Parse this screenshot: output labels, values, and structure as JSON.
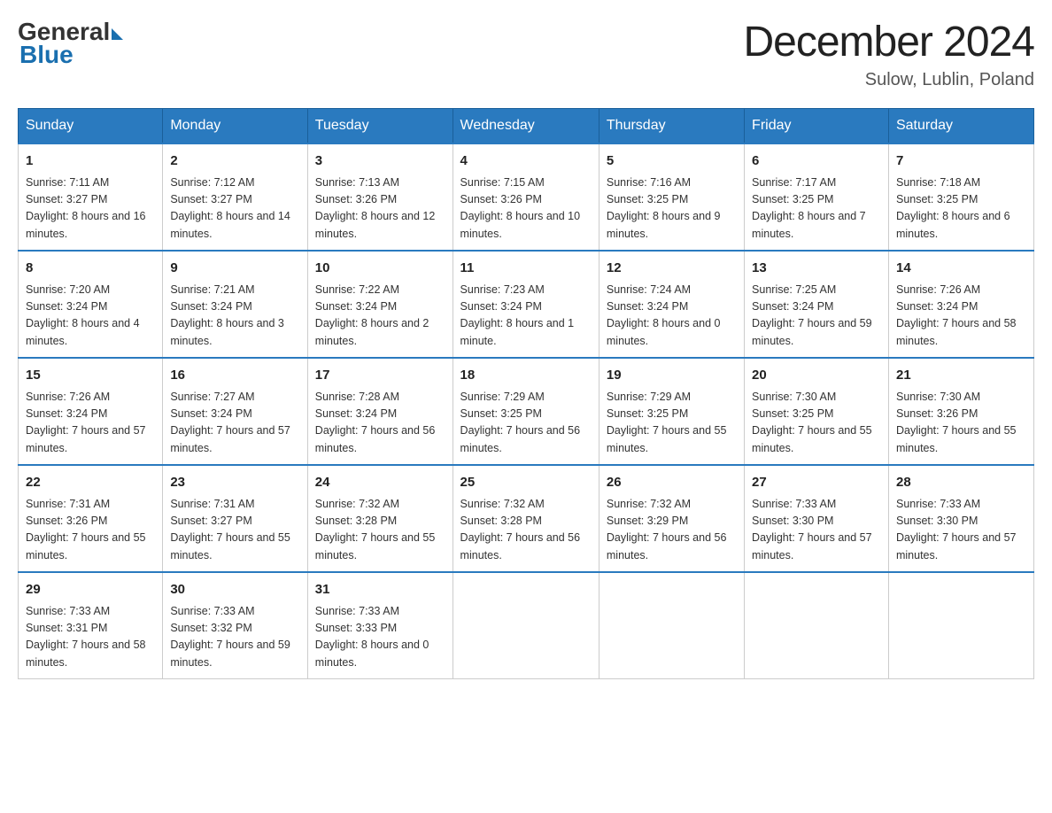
{
  "logo": {
    "general": "General",
    "blue": "Blue"
  },
  "title": {
    "month_year": "December 2024",
    "location": "Sulow, Lublin, Poland"
  },
  "days_of_week": [
    "Sunday",
    "Monday",
    "Tuesday",
    "Wednesday",
    "Thursday",
    "Friday",
    "Saturday"
  ],
  "weeks": [
    [
      {
        "day": "1",
        "sunrise": "7:11 AM",
        "sunset": "3:27 PM",
        "daylight": "8 hours and 16 minutes."
      },
      {
        "day": "2",
        "sunrise": "7:12 AM",
        "sunset": "3:27 PM",
        "daylight": "8 hours and 14 minutes."
      },
      {
        "day": "3",
        "sunrise": "7:13 AM",
        "sunset": "3:26 PM",
        "daylight": "8 hours and 12 minutes."
      },
      {
        "day": "4",
        "sunrise": "7:15 AM",
        "sunset": "3:26 PM",
        "daylight": "8 hours and 10 minutes."
      },
      {
        "day": "5",
        "sunrise": "7:16 AM",
        "sunset": "3:25 PM",
        "daylight": "8 hours and 9 minutes."
      },
      {
        "day": "6",
        "sunrise": "7:17 AM",
        "sunset": "3:25 PM",
        "daylight": "8 hours and 7 minutes."
      },
      {
        "day": "7",
        "sunrise": "7:18 AM",
        "sunset": "3:25 PM",
        "daylight": "8 hours and 6 minutes."
      }
    ],
    [
      {
        "day": "8",
        "sunrise": "7:20 AM",
        "sunset": "3:24 PM",
        "daylight": "8 hours and 4 minutes."
      },
      {
        "day": "9",
        "sunrise": "7:21 AM",
        "sunset": "3:24 PM",
        "daylight": "8 hours and 3 minutes."
      },
      {
        "day": "10",
        "sunrise": "7:22 AM",
        "sunset": "3:24 PM",
        "daylight": "8 hours and 2 minutes."
      },
      {
        "day": "11",
        "sunrise": "7:23 AM",
        "sunset": "3:24 PM",
        "daylight": "8 hours and 1 minute."
      },
      {
        "day": "12",
        "sunrise": "7:24 AM",
        "sunset": "3:24 PM",
        "daylight": "8 hours and 0 minutes."
      },
      {
        "day": "13",
        "sunrise": "7:25 AM",
        "sunset": "3:24 PM",
        "daylight": "7 hours and 59 minutes."
      },
      {
        "day": "14",
        "sunrise": "7:26 AM",
        "sunset": "3:24 PM",
        "daylight": "7 hours and 58 minutes."
      }
    ],
    [
      {
        "day": "15",
        "sunrise": "7:26 AM",
        "sunset": "3:24 PM",
        "daylight": "7 hours and 57 minutes."
      },
      {
        "day": "16",
        "sunrise": "7:27 AM",
        "sunset": "3:24 PM",
        "daylight": "7 hours and 57 minutes."
      },
      {
        "day": "17",
        "sunrise": "7:28 AM",
        "sunset": "3:24 PM",
        "daylight": "7 hours and 56 minutes."
      },
      {
        "day": "18",
        "sunrise": "7:29 AM",
        "sunset": "3:25 PM",
        "daylight": "7 hours and 56 minutes."
      },
      {
        "day": "19",
        "sunrise": "7:29 AM",
        "sunset": "3:25 PM",
        "daylight": "7 hours and 55 minutes."
      },
      {
        "day": "20",
        "sunrise": "7:30 AM",
        "sunset": "3:25 PM",
        "daylight": "7 hours and 55 minutes."
      },
      {
        "day": "21",
        "sunrise": "7:30 AM",
        "sunset": "3:26 PM",
        "daylight": "7 hours and 55 minutes."
      }
    ],
    [
      {
        "day": "22",
        "sunrise": "7:31 AM",
        "sunset": "3:26 PM",
        "daylight": "7 hours and 55 minutes."
      },
      {
        "day": "23",
        "sunrise": "7:31 AM",
        "sunset": "3:27 PM",
        "daylight": "7 hours and 55 minutes."
      },
      {
        "day": "24",
        "sunrise": "7:32 AM",
        "sunset": "3:28 PM",
        "daylight": "7 hours and 55 minutes."
      },
      {
        "day": "25",
        "sunrise": "7:32 AM",
        "sunset": "3:28 PM",
        "daylight": "7 hours and 56 minutes."
      },
      {
        "day": "26",
        "sunrise": "7:32 AM",
        "sunset": "3:29 PM",
        "daylight": "7 hours and 56 minutes."
      },
      {
        "day": "27",
        "sunrise": "7:33 AM",
        "sunset": "3:30 PM",
        "daylight": "7 hours and 57 minutes."
      },
      {
        "day": "28",
        "sunrise": "7:33 AM",
        "sunset": "3:30 PM",
        "daylight": "7 hours and 57 minutes."
      }
    ],
    [
      {
        "day": "29",
        "sunrise": "7:33 AM",
        "sunset": "3:31 PM",
        "daylight": "7 hours and 58 minutes."
      },
      {
        "day": "30",
        "sunrise": "7:33 AM",
        "sunset": "3:32 PM",
        "daylight": "7 hours and 59 minutes."
      },
      {
        "day": "31",
        "sunrise": "7:33 AM",
        "sunset": "3:33 PM",
        "daylight": "8 hours and 0 minutes."
      },
      null,
      null,
      null,
      null
    ]
  ],
  "labels": {
    "sunrise_prefix": "Sunrise: ",
    "sunset_prefix": "Sunset: ",
    "daylight_prefix": "Daylight: "
  }
}
